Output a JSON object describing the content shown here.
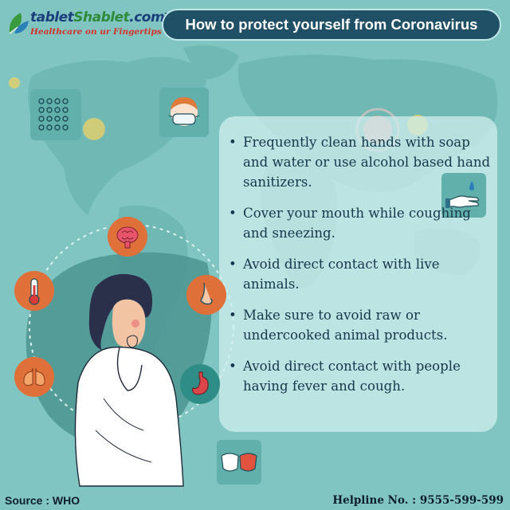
{
  "brand": {
    "name_part1": "tablet",
    "name_part2": "Shablet",
    "name_part3": ".com",
    "tm": "TM",
    "tagline": "Healthcare on ur Fingertips"
  },
  "title": "How to protect yourself from Coronavirus",
  "tips": [
    "Frequently clean hands with soap and water or use alcohol based hand sanitizers.",
    "Cover your mouth while coughing and sneezing.",
    "Avoid direct contact with live animals.",
    "Make sure to avoid raw or undercooked animal products.",
    "Avoid direct contact with people having fever and cough."
  ],
  "footer": {
    "source": "Source : WHO",
    "helpline": "Helpline No. : 9555-599-599"
  },
  "icons": {
    "symptoms": [
      "brain-icon",
      "nose-icon",
      "stomach-icon",
      "lungs-icon",
      "thermometer-icon"
    ],
    "tiles": [
      "crowd-icon",
      "mask-face-icon",
      "hand-wash-icon",
      "masks-pair-icon"
    ]
  },
  "colors": {
    "background": "#80c5c1",
    "title_pill": "#1f5066",
    "symptom_circle": "#e0703a",
    "tile": "#62b0ac",
    "text": "#16384b"
  }
}
